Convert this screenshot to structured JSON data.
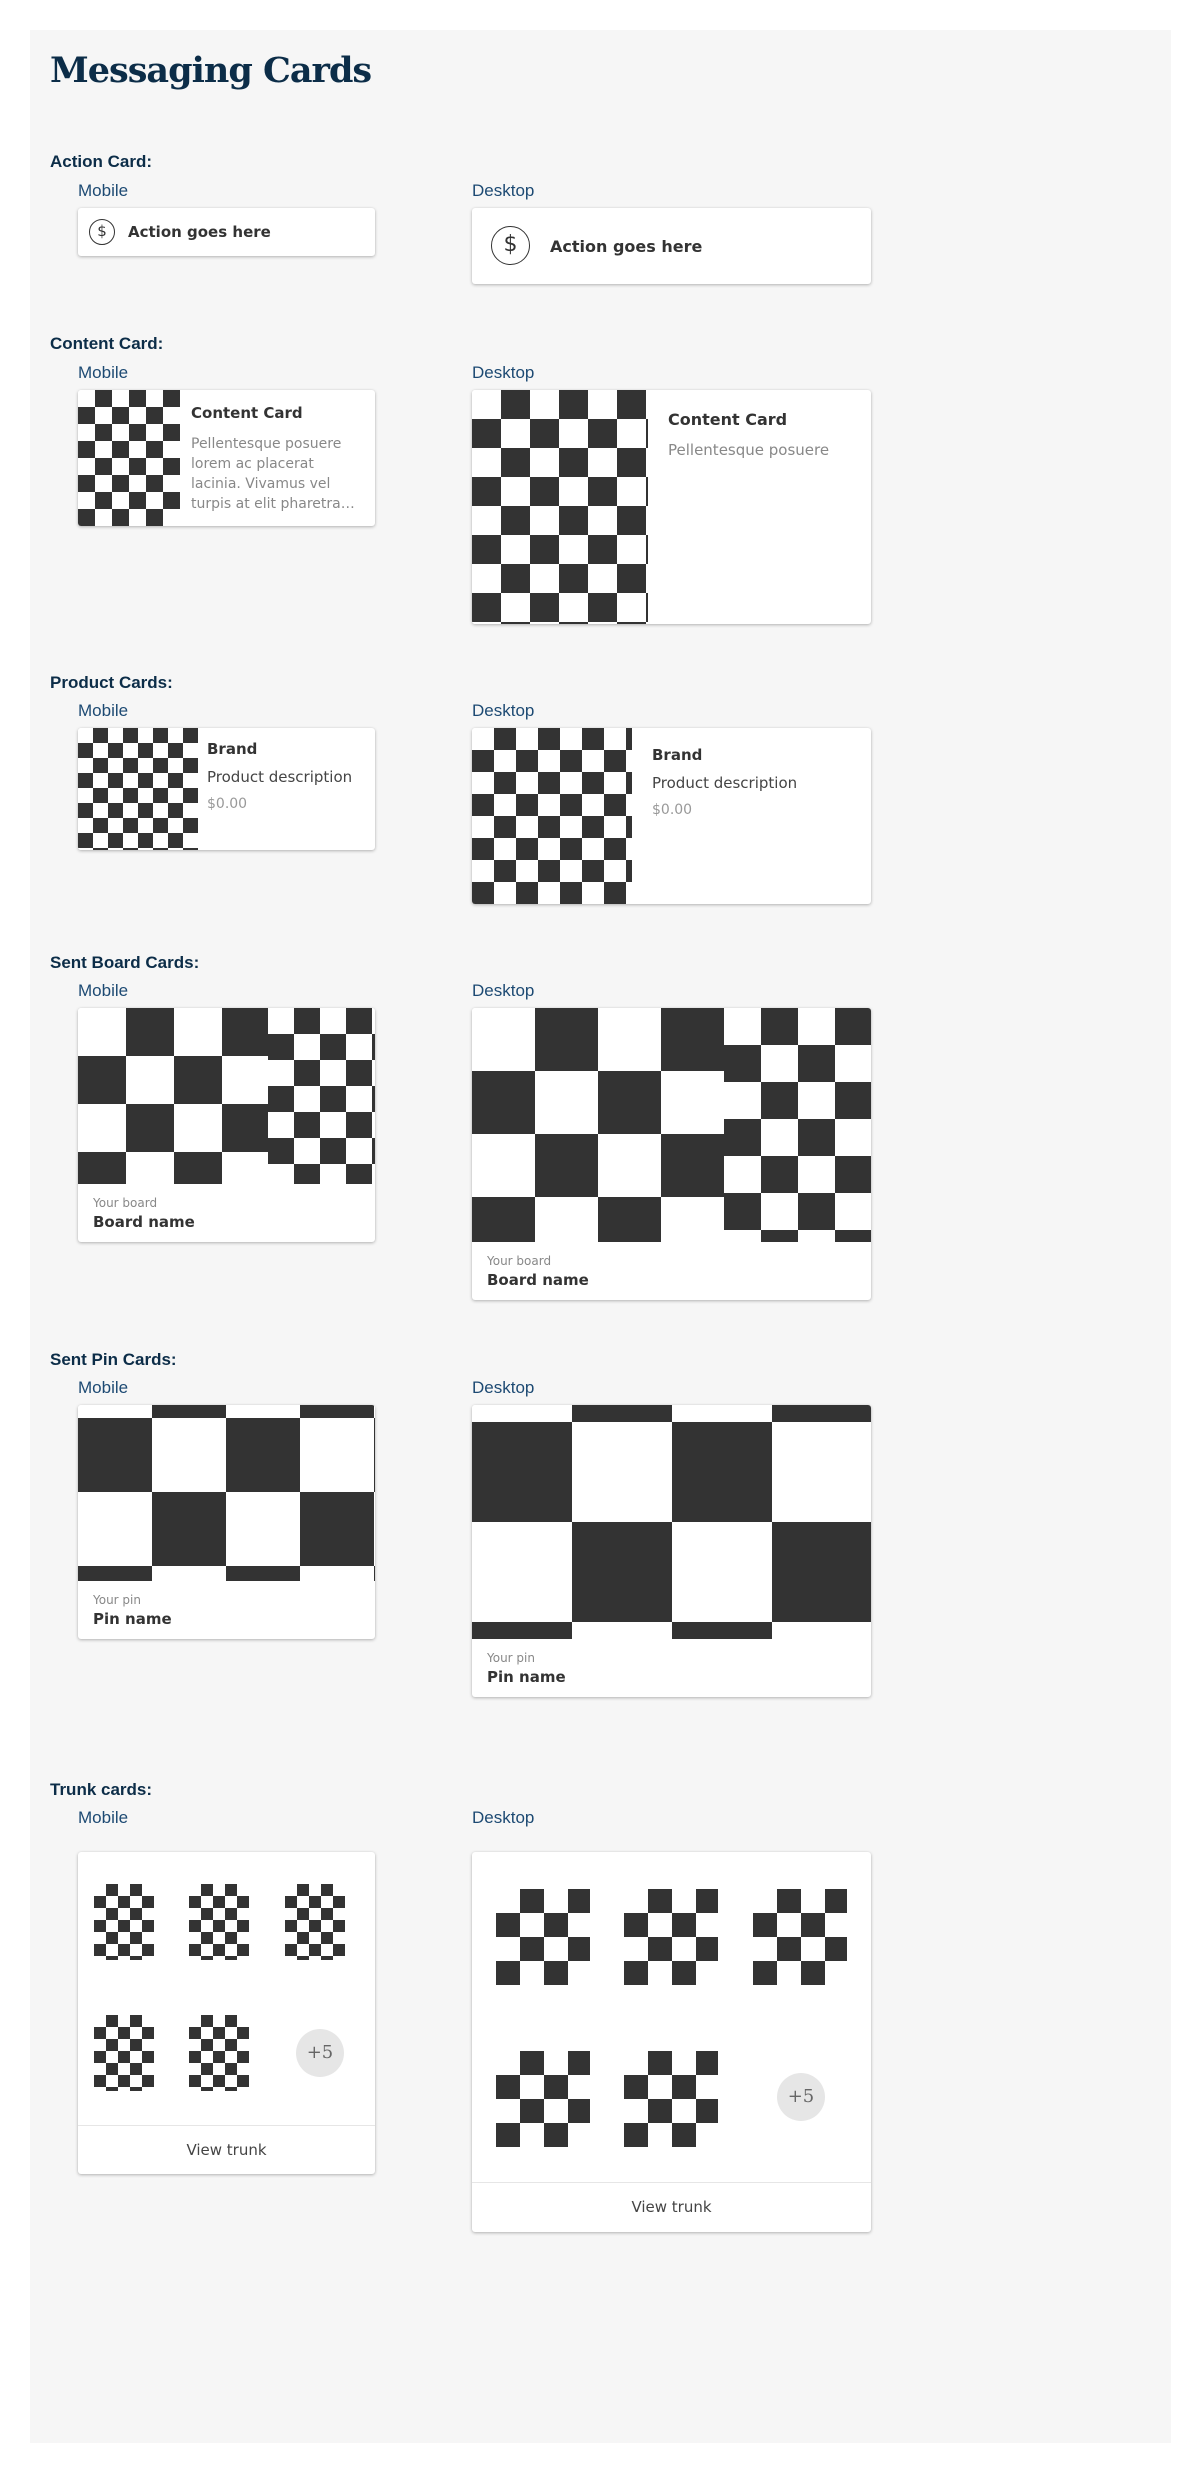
{
  "page": {
    "title": "Messaging Cards"
  },
  "labels": {
    "mobile": "Mobile",
    "desktop": "Desktop"
  },
  "sections": {
    "action": {
      "title": "Action Card:"
    },
    "content": {
      "title": "Content Card:"
    },
    "product": {
      "title": "Product Cards:"
    },
    "sent_board": {
      "title": "Sent Board Cards:"
    },
    "sent_pin": {
      "title": "Sent Pin Cards:"
    },
    "trunk": {
      "title": "Trunk cards:"
    }
  },
  "action_card": {
    "icon": "dollar-icon",
    "glyph": "$",
    "text": "Action goes here"
  },
  "content_card": {
    "title": "Content Card",
    "mobile_body": "Pellentesque posuere lorem ac placerat lacinia. Vivamus vel turpis at elit pharetra…",
    "desktop_body": "Pellentesque posuere"
  },
  "product_card": {
    "brand": "Brand",
    "description": "Product description",
    "price": "$0.00"
  },
  "board_card": {
    "label": "Your board",
    "name": "Board name"
  },
  "pin_card": {
    "label": "Your pin",
    "name": "Pin name"
  },
  "trunk_card": {
    "more": "+5",
    "button": "View trunk"
  },
  "colors": {
    "heading": "#0c2d48",
    "sublabel": "#1d4a73",
    "checker": "#333333",
    "panel": "#f6f6f6"
  }
}
